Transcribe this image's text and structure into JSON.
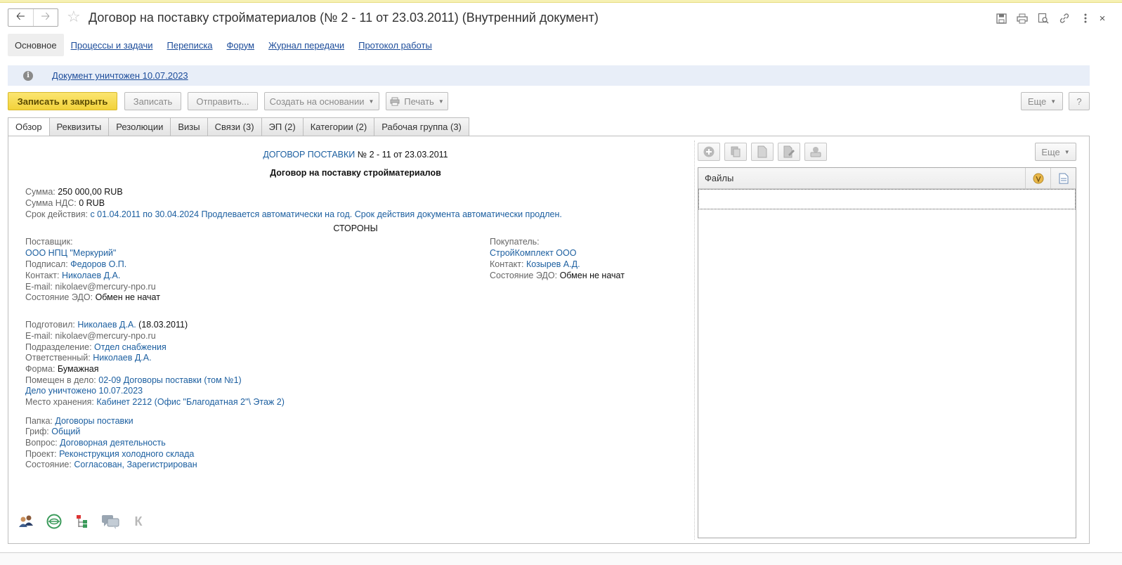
{
  "window": {
    "title": "Договор на поставку стройматериалов (№ 2 - 11 от 23.03.2011) (Внутренний документ)",
    "close_label": "×"
  },
  "sections": [
    {
      "label": "Основное"
    },
    {
      "label": "Процессы и задачи"
    },
    {
      "label": "Переписка"
    },
    {
      "label": "Форум"
    },
    {
      "label": "Журнал передачи"
    },
    {
      "label": "Протокол работы"
    }
  ],
  "infobar": {
    "text": "Документ уничтожен 10.07.2023"
  },
  "toolbar": {
    "save_close": "Записать и закрыть",
    "save": "Записать",
    "send": "Отправить...",
    "create_based": "Создать на основании",
    "print": "Печать",
    "more": "Еще",
    "help": "?"
  },
  "tabs": [
    {
      "label": "Обзор"
    },
    {
      "label": "Реквизиты"
    },
    {
      "label": "Резолюции"
    },
    {
      "label": "Визы"
    },
    {
      "label": "Связи (3)"
    },
    {
      "label": "ЭП (2)"
    },
    {
      "label": "Категории (2)"
    },
    {
      "label": "Рабочая группа (3)"
    }
  ],
  "doc": {
    "type_link": "ДОГОВОР ПОСТАВКИ",
    "number": " № 2 - 11 от 23.03.2011",
    "subject": "Договор на поставку стройматериалов",
    "sum_label": "Сумма:",
    "sum_value": "250 000,00 RUB",
    "vat_label": "Сумма НДС:",
    "vat_value": "0 RUB",
    "term_label": "Срок действия:",
    "term_value": "с 01.04.2011 по 30.04.2024 Продлевается автоматически на год. Срок действия документа автоматически продлен.",
    "parties": "СТОРОНЫ",
    "supplier": {
      "label": "Поставщик:",
      "name": "ООО НПЦ \"Меркурий\"",
      "signed_label": "Подписал:",
      "signed": "Федоров О.П.",
      "contact_label": "Контакт:",
      "contact": "Николаев Д.А.",
      "email": "E-mail: nikolaev@mercury-npo.ru",
      "edo_label": "Состояние ЭДО:",
      "edo": "Обмен не начат"
    },
    "buyer": {
      "label": "Покупатель:",
      "name": "СтройКомплект ООО",
      "contact_label": "Контакт:",
      "contact": "Козырев А.Д.",
      "edo_label": "Состояние ЭДО:",
      "edo": "Обмен не начат"
    },
    "prepared_label": "Подготовил:",
    "prepared": "Николаев Д.А.",
    "prepared_date": "(18.03.2011)",
    "prepared_email": "E-mail: nikolaev@mercury-npo.ru",
    "dept_label": "Подразделение:",
    "dept": "Отдел снабжения",
    "resp_label": "Ответственный:",
    "resp": "Николаев Д.А.",
    "form_label": "Форма:",
    "form": "Бумажная",
    "case_label": "Помещен в дело:",
    "case": "02-09 Договоры поставки (том №1)",
    "case_destroyed": "Дело уничтожено 10.07.2023",
    "storage_label": "Место хранения:",
    "storage": "Кабинет 2212 (Офис \"Благодатная 2\"\\ Этаж 2)",
    "folder_label": "Папка:",
    "folder": "Договоры поставки",
    "grif_label": "Гриф:",
    "grif": "Общий",
    "question_label": "Вопрос:",
    "question": "Договорная деятельность",
    "project_label": "Проект:",
    "project": "Реконструкция холодного склада",
    "status_label": "Состояние:",
    "status": "Согласован, Зарегистрирован"
  },
  "bottom_icons": [
    "users-icon",
    "globe-icon",
    "tree-icon",
    "chat-icon",
    "k-icon"
  ],
  "bottom_k": "К",
  "files": {
    "more": "Еще",
    "column": "Файлы",
    "toolbar_icons": [
      "add-icon",
      "copy-icon",
      "file-icon",
      "edit-file-icon",
      "scanner-icon"
    ]
  }
}
